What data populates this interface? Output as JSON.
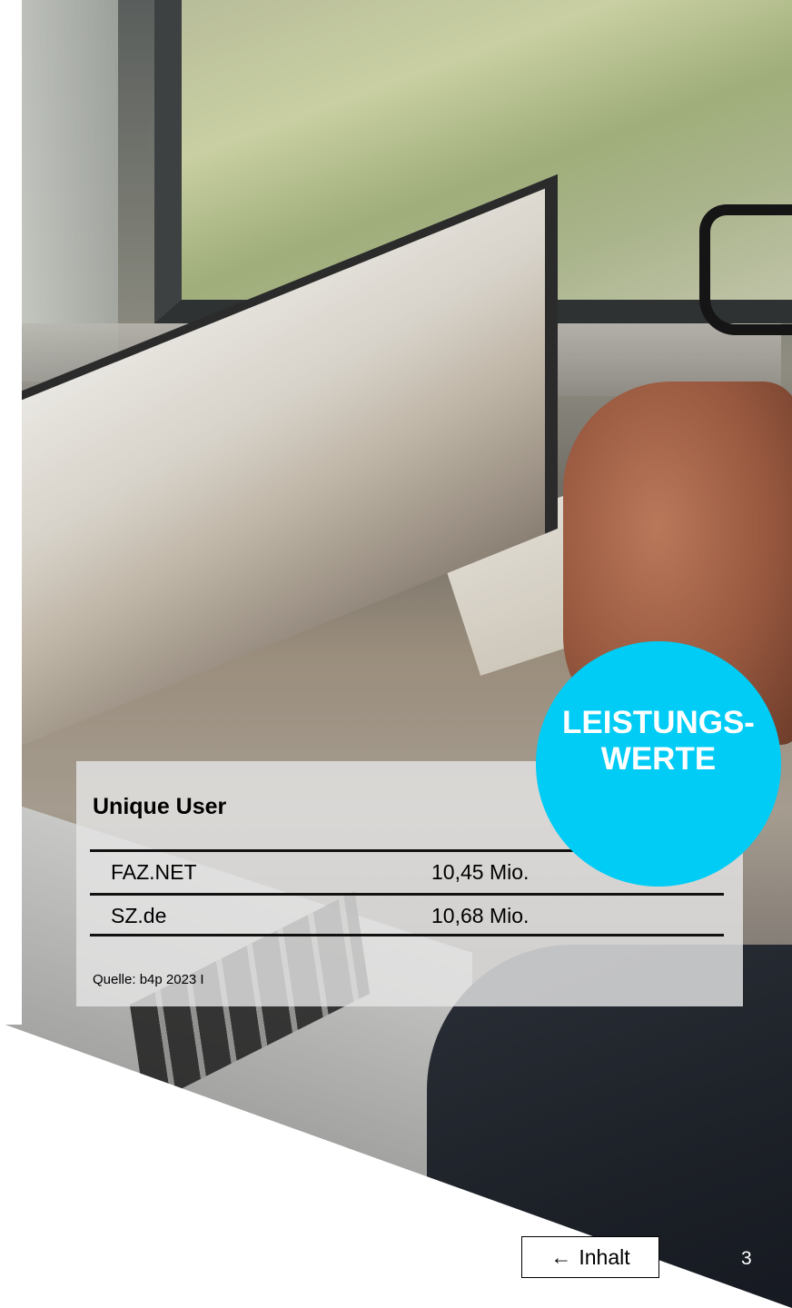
{
  "panel": {
    "title": "Unique User",
    "rows": [
      {
        "name": "FAZ.NET",
        "value": "10,45 Mio."
      },
      {
        "name": "SZ.de",
        "value": "10,68 Mio."
      }
    ],
    "source": "Quelle: b4p 2023 I"
  },
  "badge": {
    "line1": "LEISTUNGS-",
    "line2": "WERTE",
    "color": "#00ccf5"
  },
  "nav": {
    "arrow": "←",
    "label": "Inhalt"
  },
  "page_number": "3"
}
